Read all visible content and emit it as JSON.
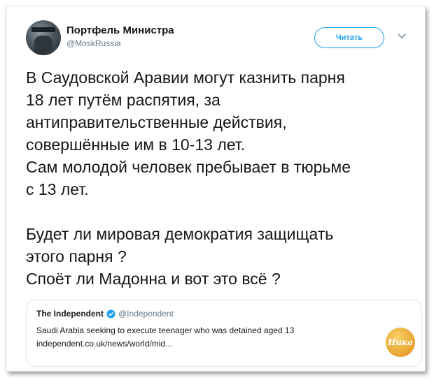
{
  "tweet": {
    "author": {
      "display_name": "Портфель Министра",
      "handle": "@MoskRussia",
      "avatar_icon": "profile-avatar"
    },
    "follow_button_label": "Читать",
    "menu_icon": "chevron-down-icon",
    "text": "В Саудовской Аравии могут казнить парня\n18 лет путём распятия, за\nантиправительственные действия,\nсовершённые им в 10-13 лет.\nСам молодой человек пребывает в тюрьме\nс 13 лет.\n\nБудет ли мировая демократия защищать\nэтого парня ?\nСпоёт ли Мадонна и вот это всё ?"
  },
  "quoted_tweet": {
    "display_name": "The Independent",
    "verified_icon": "verified-badge-icon",
    "handle": "@Independent",
    "text": "Saudi Arabia seeking to execute teenager who was detained aged 13",
    "link": "independent.co.uk/news/world/mid..."
  },
  "watermark": {
    "text": "Ника"
  },
  "colors": {
    "accent": "#1da1f2",
    "text": "#14171a",
    "muted": "#657786",
    "border": "#e1e8ed"
  }
}
